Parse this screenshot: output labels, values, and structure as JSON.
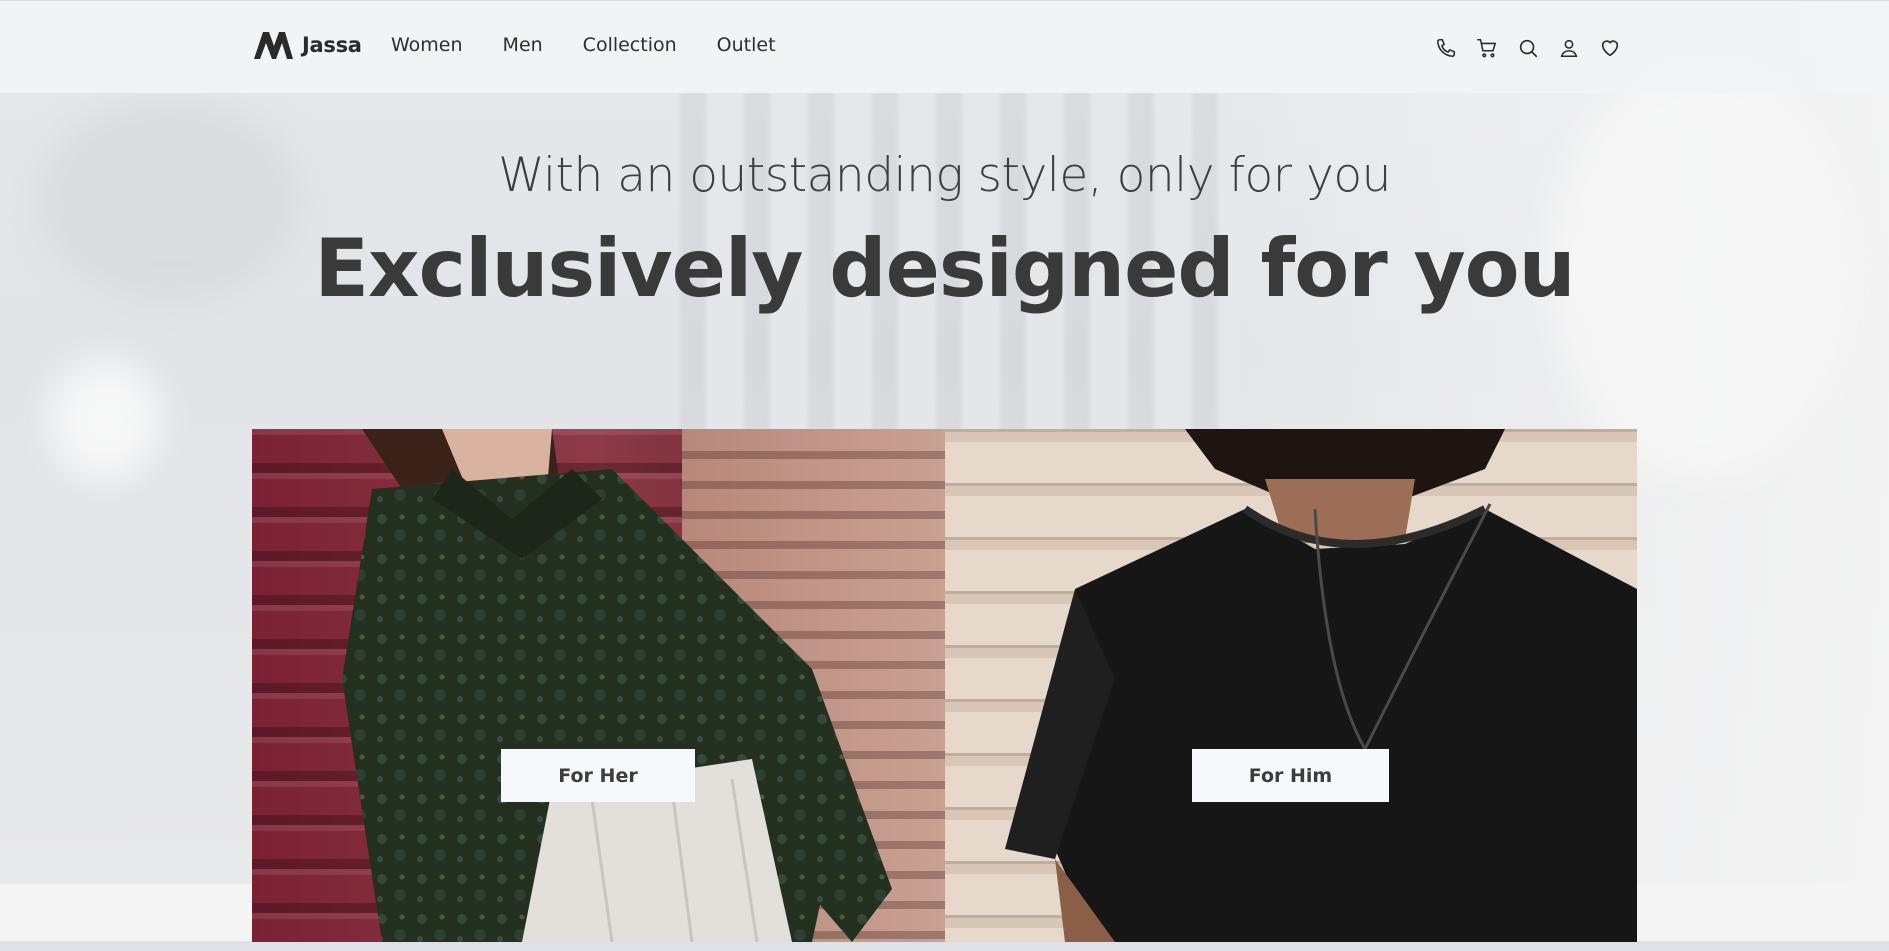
{
  "brand": {
    "name": "Jassa",
    "logo_icon": "jassa-logo-icon"
  },
  "nav": {
    "items": [
      {
        "label": "Women"
      },
      {
        "label": "Men"
      },
      {
        "label": "Collection"
      },
      {
        "label": "Outlet"
      }
    ]
  },
  "header_icons": [
    "phone-icon",
    "cart-icon",
    "search-icon",
    "user-icon",
    "heart-icon"
  ],
  "hero": {
    "subtitle": "With an outstanding style, only for you",
    "title": "Exclusively designed for you"
  },
  "cards": [
    {
      "button_label": "For Her"
    },
    {
      "button_label": "For Him"
    }
  ],
  "colors": {
    "header_bg": "#f2f3f5",
    "text_dark": "#3a3a3a",
    "button_bg": "#f7f8fb"
  }
}
